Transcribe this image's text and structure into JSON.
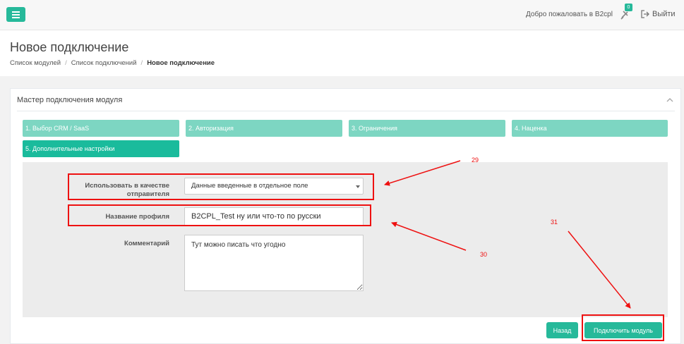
{
  "header": {
    "welcome": "Добро пожаловать в B2cpl",
    "notifications_count": "0",
    "logout": "Выйти"
  },
  "page": {
    "title": "Новое подключение",
    "breadcrumb": [
      "Список модулей",
      "Список подключений",
      "Новое подключение"
    ]
  },
  "wizard": {
    "title": "Мастер подключения модуля",
    "steps": [
      {
        "label": "1. Выбор CRM / SaaS"
      },
      {
        "label": "2. Авторизация"
      },
      {
        "label": "3. Ограничения"
      },
      {
        "label": "4. Наценка"
      },
      {
        "label": "5. Дополнительные настройки"
      }
    ]
  },
  "form": {
    "sender_label": "Использовать в качестве отправителя",
    "sender_value": "Данные введенные в отдельное поле",
    "profile_label": "Название профиля",
    "profile_value": "B2CPL_Test ну или что-то по русски",
    "comment_label": "Комментарий",
    "comment_value": "Тут можно писать что угодно"
  },
  "actions": {
    "back": "Назад",
    "connect": "Подключить модуль"
  },
  "annotations": {
    "n29": "29",
    "n30": "30",
    "n31": "31"
  },
  "colors": {
    "accent": "#26b99a",
    "step_inactive": "#7dd6c2",
    "annotation": "#ee1111"
  }
}
